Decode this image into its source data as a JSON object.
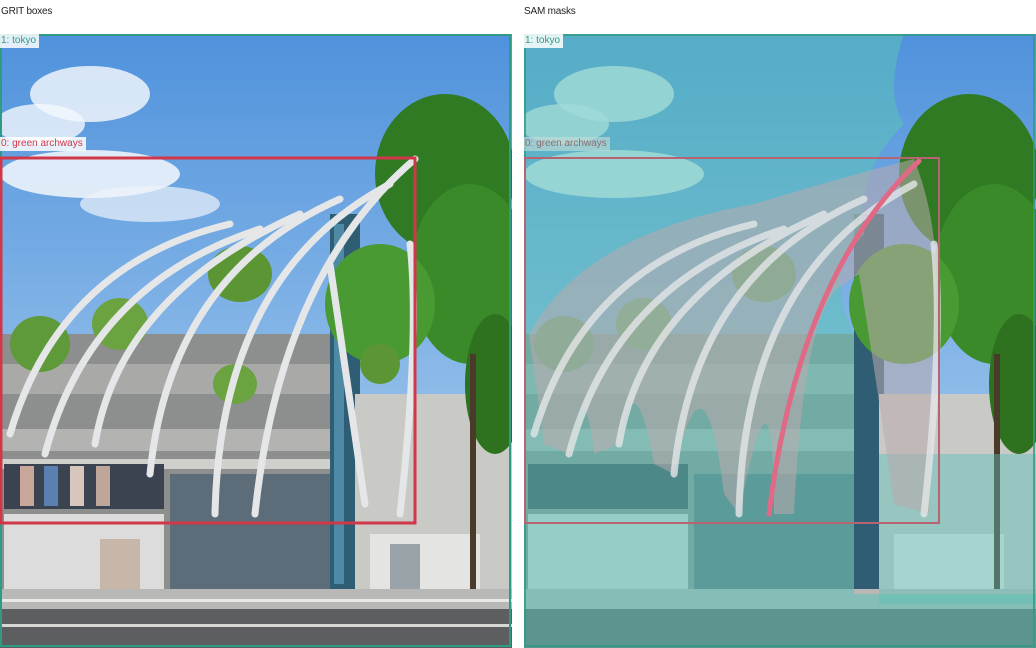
{
  "panels": {
    "left": {
      "title": "GRIT boxes"
    },
    "right": {
      "title": "SAM masks"
    }
  },
  "detections": [
    {
      "label": "1: tokyo",
      "color": "#2f9b82"
    },
    {
      "label": "0: green archways",
      "color": "#d0384a"
    }
  ],
  "colors": {
    "tokyo_box": "#2f9b82",
    "archway_box": "#d0384a",
    "tokyo_mask": "#5bc2b6",
    "archway_mask": "#b9a9ad",
    "archway_mask_edge": "#e06a86"
  }
}
